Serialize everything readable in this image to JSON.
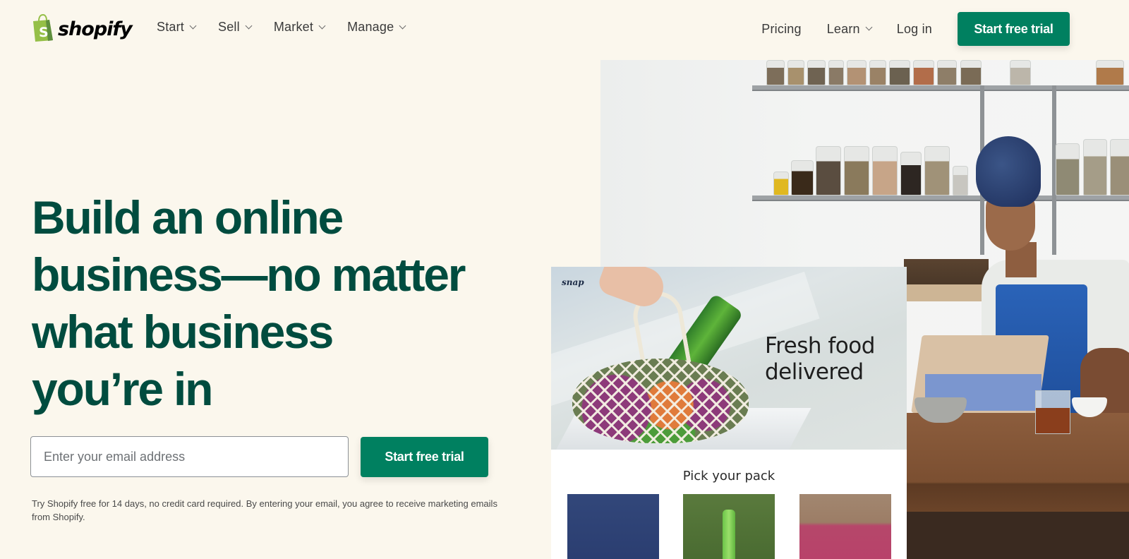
{
  "header": {
    "logo_text": "shopify",
    "nav_left": [
      {
        "label": "Start",
        "has_dropdown": true
      },
      {
        "label": "Sell",
        "has_dropdown": true
      },
      {
        "label": "Market",
        "has_dropdown": true
      },
      {
        "label": "Manage",
        "has_dropdown": true
      }
    ],
    "nav_right": [
      {
        "label": "Pricing",
        "has_dropdown": false
      },
      {
        "label": "Learn",
        "has_dropdown": true
      },
      {
        "label": "Log in",
        "has_dropdown": false
      }
    ],
    "cta_label": "Start free trial"
  },
  "hero": {
    "headline_lines": [
      "Build an online",
      "business—no matter",
      "what business",
      "you’re in"
    ],
    "email_placeholder": "Enter your email address",
    "email_value": "",
    "cta_label": "Start free trial",
    "disclaimer": "Try Shopify free for 14 days, no credit card required. By entering your email, you agree to receive marketing emails from Shopify."
  },
  "store_preview": {
    "brand": "snap",
    "tagline": "Fresh food delivered",
    "section_title": "Pick your pack"
  },
  "colors": {
    "brand_green": "#008060",
    "headline_green": "#004c3f",
    "logo_green": "#95bf47",
    "background": "#fbf7ed"
  }
}
